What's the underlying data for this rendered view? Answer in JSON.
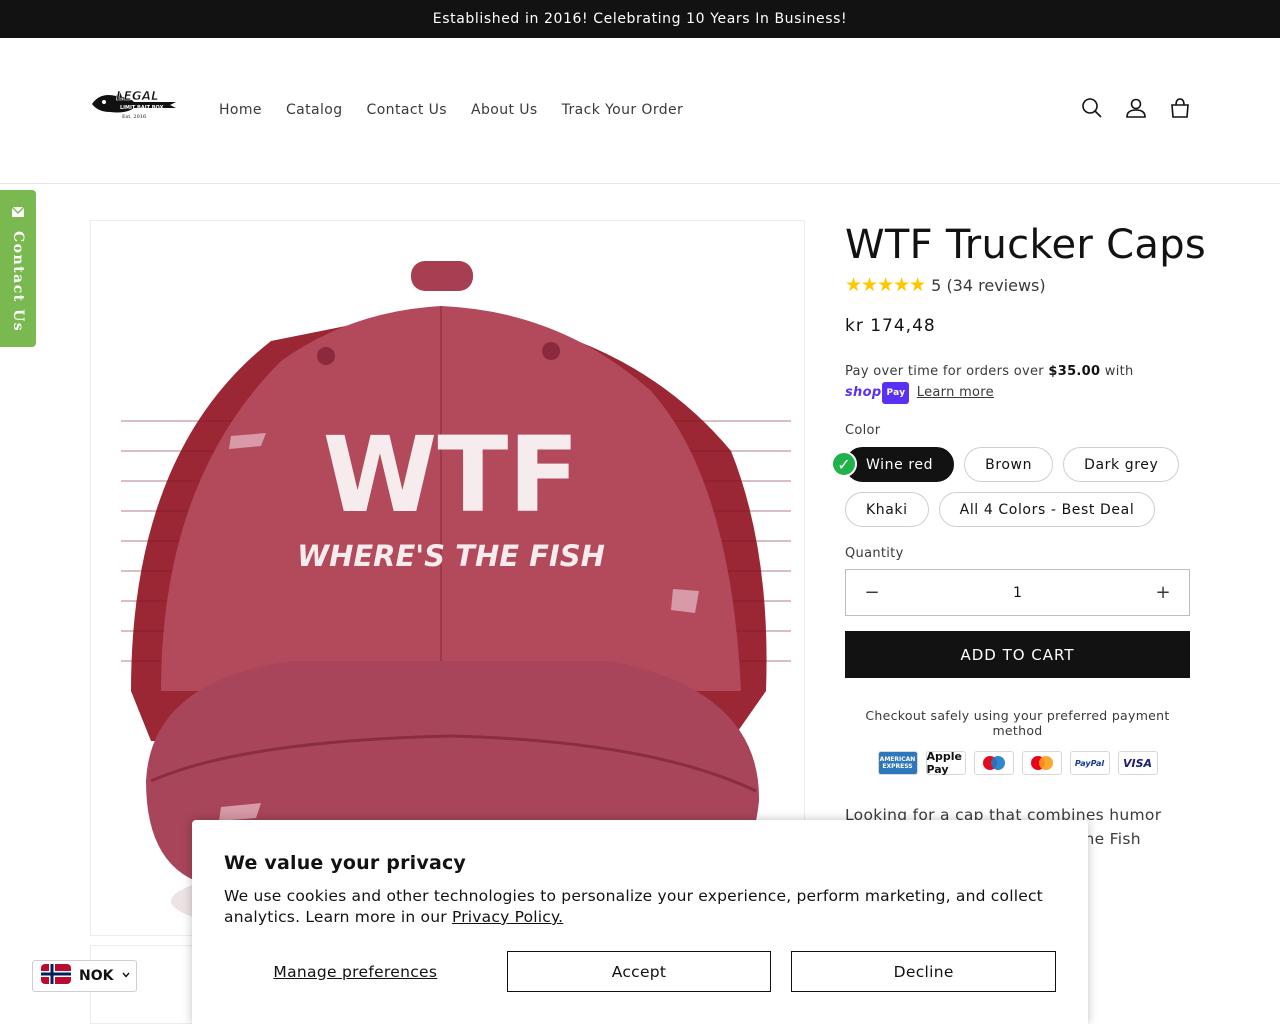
{
  "announcement": {
    "text": "Established in 2016! Celebrating 10 Years In Business!"
  },
  "header": {
    "logo": {
      "word": "LEGAL",
      "sub": "LIMIT BAIT BOX",
      "est": "Est. 2016"
    },
    "nav": [
      "Home",
      "Catalog",
      "Contact Us",
      "About Us",
      "Track Your Order"
    ]
  },
  "contact_tab": {
    "label": "Contact Us"
  },
  "gallery": {
    "cap_main_text": "WTF",
    "cap_sub_text": "WHERE'S THE FISH",
    "cap_color": "#b24a5c",
    "mesh_color": "#9b2634"
  },
  "product": {
    "title": "WTF Trucker Caps",
    "stars": "★★★★★",
    "rating_text": "5 (34 reviews)",
    "price": "kr 174,48",
    "shoppay": {
      "prefix": "Pay over time for orders over",
      "amount": "$35.00",
      "suffix": "with",
      "logo": "shop",
      "logo_pay": "Pay",
      "learn_more": "Learn more"
    },
    "color_label": "Color",
    "colors": [
      "Wine red",
      "Brown",
      "Dark grey",
      "Khaki",
      "All 4 Colors - Best Deal"
    ],
    "selected_color": "Wine red",
    "quantity_label": "Quantity",
    "quantity": "1",
    "add_to_cart": "ADD TO CART",
    "checkout_text": "Checkout safely using your preferred payment method",
    "payment_methods": [
      "AMERICAN EXPRESS",
      "Apple Pay",
      "Maestro",
      "Mastercard",
      "PayPal",
      "VISA"
    ],
    "description": "Looking for a cap that combines humor and style? The WTF Where’s the Fish Trucker"
  },
  "cookie": {
    "title": "We value your privacy",
    "body": "We use cookies and other technologies to personalize your experience, perform marketing, and collect analytics. Learn more in our",
    "policy_link": "Privacy Policy.",
    "manage": "Manage preferences",
    "accept": "Accept",
    "decline": "Decline"
  },
  "currency": {
    "code": "NOK"
  }
}
